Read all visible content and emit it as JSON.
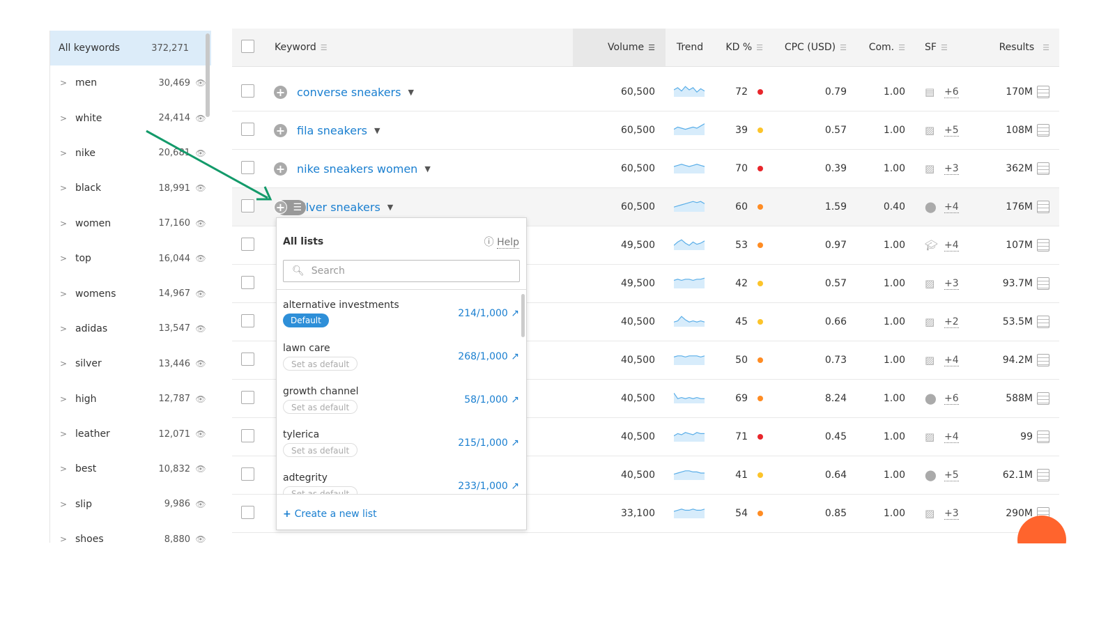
{
  "sidebar": {
    "header": {
      "label": "All keywords",
      "count": "372,271"
    },
    "items": [
      {
        "label": "men",
        "count": "30,469"
      },
      {
        "label": "white",
        "count": "24,414"
      },
      {
        "label": "nike",
        "count": "20,681"
      },
      {
        "label": "black",
        "count": "18,991"
      },
      {
        "label": "women",
        "count": "17,160"
      },
      {
        "label": "top",
        "count": "16,044"
      },
      {
        "label": "womens",
        "count": "14,967"
      },
      {
        "label": "adidas",
        "count": "13,547"
      },
      {
        "label": "silver",
        "count": "13,446"
      },
      {
        "label": "high",
        "count": "12,787"
      },
      {
        "label": "leather",
        "count": "12,071"
      },
      {
        "label": "best",
        "count": "10,832"
      },
      {
        "label": "slip",
        "count": "9,986"
      },
      {
        "label": "shoes",
        "count": "8,880"
      }
    ]
  },
  "table": {
    "headers": {
      "keyword": "Keyword",
      "volume": "Volume",
      "trend": "Trend",
      "kd": "KD %",
      "cpc": "CPC (USD)",
      "com": "Com.",
      "sf": "SF",
      "results": "Results"
    },
    "rows": [
      {
        "keyword": "converse sneakers",
        "volume": "60,500",
        "kd": "72",
        "kd_color": "#e8262b",
        "cpc": "0.79",
        "com": "1.00",
        "sf_icon": "news-icon",
        "sf": "+6",
        "results": "170M",
        "trend": [
          5,
          7,
          4,
          8,
          5,
          7,
          3,
          6,
          4
        ]
      },
      {
        "keyword": "fila sneakers",
        "volume": "60,500",
        "kd": "39",
        "kd_color": "#fcc42a",
        "cpc": "0.57",
        "com": "1.00",
        "sf_icon": "image-icon",
        "sf": "+5",
        "results": "108M",
        "trend": [
          4,
          6,
          5,
          4,
          5,
          6,
          5,
          7,
          9
        ]
      },
      {
        "keyword": "nike sneakers women",
        "volume": "60,500",
        "kd": "70",
        "kd_color": "#e8262b",
        "cpc": "0.39",
        "com": "1.00",
        "sf_icon": "image-icon",
        "sf": "+3",
        "results": "362M",
        "trend": [
          5,
          6,
          7,
          6,
          5,
          6,
          7,
          6,
          5
        ]
      },
      {
        "keyword": "silver sneakers",
        "visible_keyword": "lver sneakers",
        "volume": "60,500",
        "kd": "60",
        "kd_color": "#ff8c23",
        "cpc": "1.59",
        "com": "0.40",
        "sf_icon": "location-icon",
        "sf": "+4",
        "results": "176M",
        "trend": [
          3,
          4,
          5,
          6,
          7,
          8,
          7,
          8,
          6
        ]
      },
      {
        "volume": "49,500",
        "kd": "53",
        "kd_color": "#ff8c23",
        "cpc": "0.97",
        "com": "1.00",
        "sf_icon": "education-icon",
        "sf": "+4",
        "results": "107M",
        "trend": [
          3,
          6,
          8,
          5,
          3,
          6,
          4,
          5,
          7
        ]
      },
      {
        "volume": "49,500",
        "kd": "42",
        "kd_color": "#fcc42a",
        "cpc": "0.57",
        "com": "1.00",
        "sf_icon": "image-icon",
        "sf": "+3",
        "results": "93.7M",
        "trend": [
          6,
          7,
          6,
          7,
          7,
          6,
          7,
          7,
          8
        ]
      },
      {
        "volume": "40,500",
        "kd": "45",
        "kd_color": "#fcc42a",
        "cpc": "0.66",
        "com": "1.00",
        "sf_icon": "image-icon",
        "sf": "+2",
        "results": "53.5M",
        "trend": [
          3,
          4,
          8,
          5,
          3,
          4,
          3,
          4,
          3
        ]
      },
      {
        "volume": "40,500",
        "kd": "50",
        "kd_color": "#ff8c23",
        "cpc": "0.73",
        "com": "1.00",
        "sf_icon": "image-icon",
        "sf": "+4",
        "results": "94.2M",
        "trend": [
          6,
          7,
          7,
          6,
          7,
          7,
          7,
          6,
          7
        ]
      },
      {
        "volume": "40,500",
        "kd": "69",
        "kd_color": "#ff8c23",
        "cpc": "8.24",
        "com": "1.00",
        "sf_icon": "location-icon",
        "sf": "+6",
        "results": "588M",
        "trend": [
          8,
          3,
          4,
          3,
          4,
          3,
          4,
          3,
          3
        ]
      },
      {
        "volume": "40,500",
        "kd": "71",
        "kd_color": "#e8262b",
        "cpc": "0.45",
        "com": "1.00",
        "sf_icon": "image-icon",
        "sf": "+4",
        "results": "99",
        "trend": [
          4,
          6,
          5,
          7,
          6,
          5,
          7,
          6,
          6
        ]
      },
      {
        "volume": "40,500",
        "kd": "41",
        "kd_color": "#fcc42a",
        "cpc": "0.64",
        "com": "1.00",
        "sf_icon": "location-icon",
        "sf": "+5",
        "results": "62.1M",
        "trend": [
          4,
          5,
          6,
          7,
          7,
          6,
          6,
          5,
          5
        ]
      },
      {
        "volume": "33,100",
        "kd": "54",
        "kd_color": "#ff8c23",
        "cpc": "0.85",
        "com": "1.00",
        "sf_icon": "image-icon",
        "sf": "+3",
        "results": "290M",
        "trend": [
          5,
          6,
          7,
          6,
          6,
          7,
          6,
          6,
          7
        ]
      }
    ]
  },
  "dropdown": {
    "title": "All lists",
    "help": "Help",
    "search_placeholder": "Search",
    "create": "Create a new list",
    "lists": [
      {
        "name": "alternative investments",
        "badge": "Default",
        "count": "214/1,000",
        "default": true
      },
      {
        "name": "lawn care",
        "badge": "Set as default",
        "count": "268/1,000"
      },
      {
        "name": "growth channel",
        "badge": "Set as default",
        "count": "58/1,000"
      },
      {
        "name": "tylerica",
        "badge": "Set as default",
        "count": "215/1,000"
      },
      {
        "name": "adtegrity",
        "badge": "Set as default",
        "count": "233/1,000"
      }
    ]
  }
}
